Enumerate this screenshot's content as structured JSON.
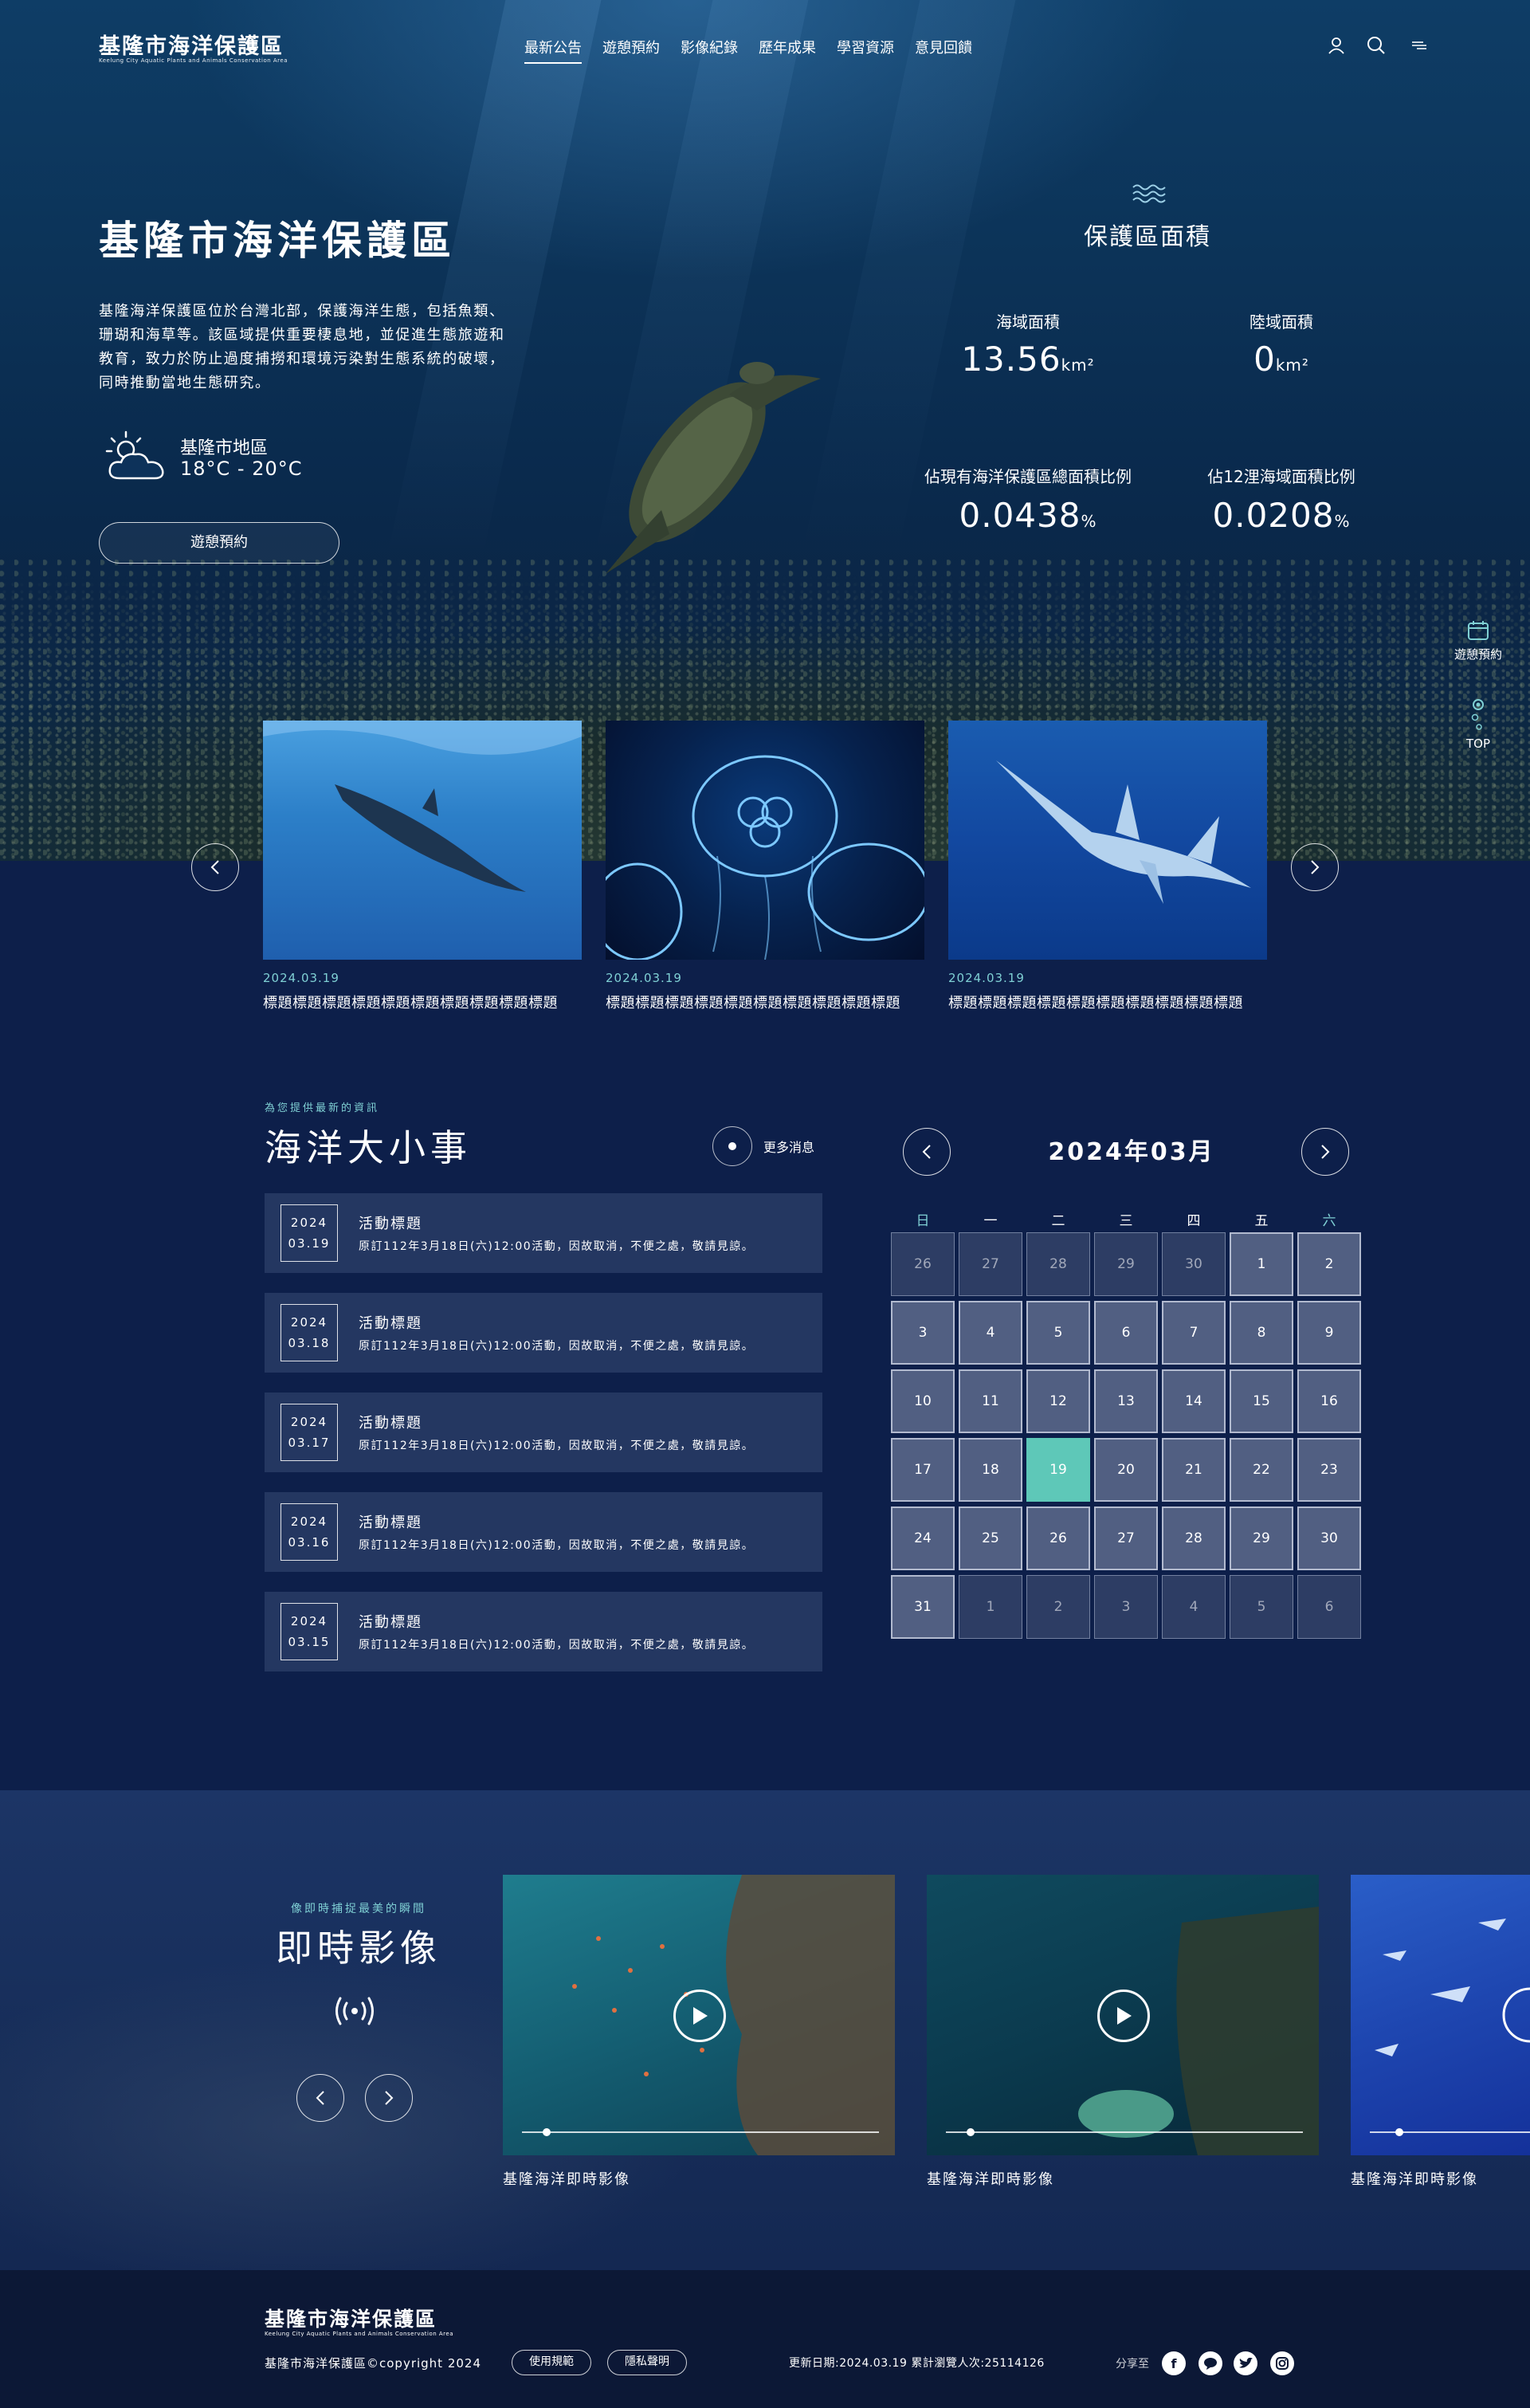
{
  "header": {
    "logo_title": "基隆市海洋保護區",
    "logo_sub": "Keelung City Aquatic Plants and Animals Conservation Area",
    "nav": [
      "最新公告",
      "遊憩預約",
      "影像紀錄",
      "歷年成果",
      "學習資源",
      "意見回饋"
    ],
    "active_nav": "最新公告",
    "icons": [
      "user-icon",
      "search-icon",
      "menu-icon"
    ]
  },
  "hero": {
    "title": "基隆市海洋保護區",
    "description": "基隆海洋保護區位於台灣北部，保護海洋生態，包括魚類、珊瑚和海草等。該區域提供重要棲息地，並促進生態旅遊和教育，致力於防止過度捕撈和環境污染對生態系統的破壞，同時推動當地生態研究。",
    "weather": {
      "location": "基隆市地區",
      "temp": "18°C - 20°C",
      "icon": "partly-cloudy-icon"
    },
    "cta": "遊憩預約"
  },
  "stats": {
    "title": "保護區面積",
    "items": [
      {
        "label": "海域面積",
        "value": "13.56",
        "unit": "km²"
      },
      {
        "label": "陸域面積",
        "value": "0",
        "unit": "km²"
      },
      {
        "label": "佔現有海洋保護區總面積比例",
        "value": "0.0438",
        "unit": "%"
      },
      {
        "label": "佔12浬海域面積比例",
        "value": "0.0208",
        "unit": "%"
      }
    ]
  },
  "side": {
    "booking": "遊憩預約",
    "top": "TOP"
  },
  "carousel": [
    {
      "date": "2024.03.19",
      "title": "標題標題標題標題標題標題標題標題標題標題"
    },
    {
      "date": "2024.03.19",
      "title": "標題標題標題標題標題標題標題標題標題標題"
    },
    {
      "date": "2024.03.19",
      "title": "標題標題標題標題標題標題標題標題標題標題"
    }
  ],
  "news": {
    "kicker": "為您提供最新的資訊",
    "title": "海洋大小事",
    "more": "更多消息",
    "items": [
      {
        "year": "2024",
        "md": "03.19",
        "title": "活動標題",
        "desc": "原訂112年3月18日(六)12:00活動，因故取消，不便之處，敬請見諒。"
      },
      {
        "year": "2024",
        "md": "03.18",
        "title": "活動標題",
        "desc": "原訂112年3月18日(六)12:00活動，因故取消，不便之處，敬請見諒。"
      },
      {
        "year": "2024",
        "md": "03.17",
        "title": "活動標題",
        "desc": "原訂112年3月18日(六)12:00活動，因故取消，不便之處，敬請見諒。"
      },
      {
        "year": "2024",
        "md": "03.16",
        "title": "活動標題",
        "desc": "原訂112年3月18日(六)12:00活動，因故取消，不便之處，敬請見諒。"
      },
      {
        "year": "2024",
        "md": "03.15",
        "title": "活動標題",
        "desc": "原訂112年3月18日(六)12:00活動，因故取消，不便之處，敬請見諒。"
      }
    ]
  },
  "calendar": {
    "title": "2024年03月",
    "weekdays": [
      "日",
      "一",
      "二",
      "三",
      "四",
      "五",
      "六"
    ],
    "days": [
      "26",
      "27",
      "28",
      "29",
      "30",
      "1",
      "2",
      "3",
      "4",
      "5",
      "6",
      "7",
      "8",
      "9",
      "10",
      "11",
      "12",
      "13",
      "14",
      "15",
      "16",
      "17",
      "18",
      "19",
      "20",
      "21",
      "22",
      "23",
      "24",
      "25",
      "26",
      "27",
      "28",
      "29",
      "30",
      "31",
      "1",
      "2",
      "3",
      "4",
      "5",
      "6"
    ],
    "dim_before": 5,
    "dim_after_from": 36,
    "today_index": 23
  },
  "live": {
    "kicker": "像即時捕捉最美的瞬間",
    "title": "即時影像",
    "broadcast_icon": "broadcast-icon",
    "videos": [
      {
        "caption": "基隆海洋即時影像",
        "progress": 0.07
      },
      {
        "caption": "基隆海洋即時影像",
        "progress": 0.07
      },
      {
        "caption": "基隆海洋即時影像",
        "progress": 0.07
      }
    ]
  },
  "footer": {
    "title": "基隆市海洋保護區",
    "sub": "Keelung City Aquatic Plants and Animals Conservation Area",
    "copyright": "基隆市海洋保護區©copyright 2024",
    "terms": "使用規範",
    "privacy": "隱私聲明",
    "updated": "更新日期:2024.03.19   累計瀏覽人次:25114126",
    "share": "分享至",
    "social": [
      "facebook-icon",
      "line-icon",
      "twitter-icon",
      "instagram-icon"
    ]
  },
  "colors": {
    "accent": "#7fd0d4",
    "today": "#5ec8b8",
    "footer": "#0c1836"
  }
}
